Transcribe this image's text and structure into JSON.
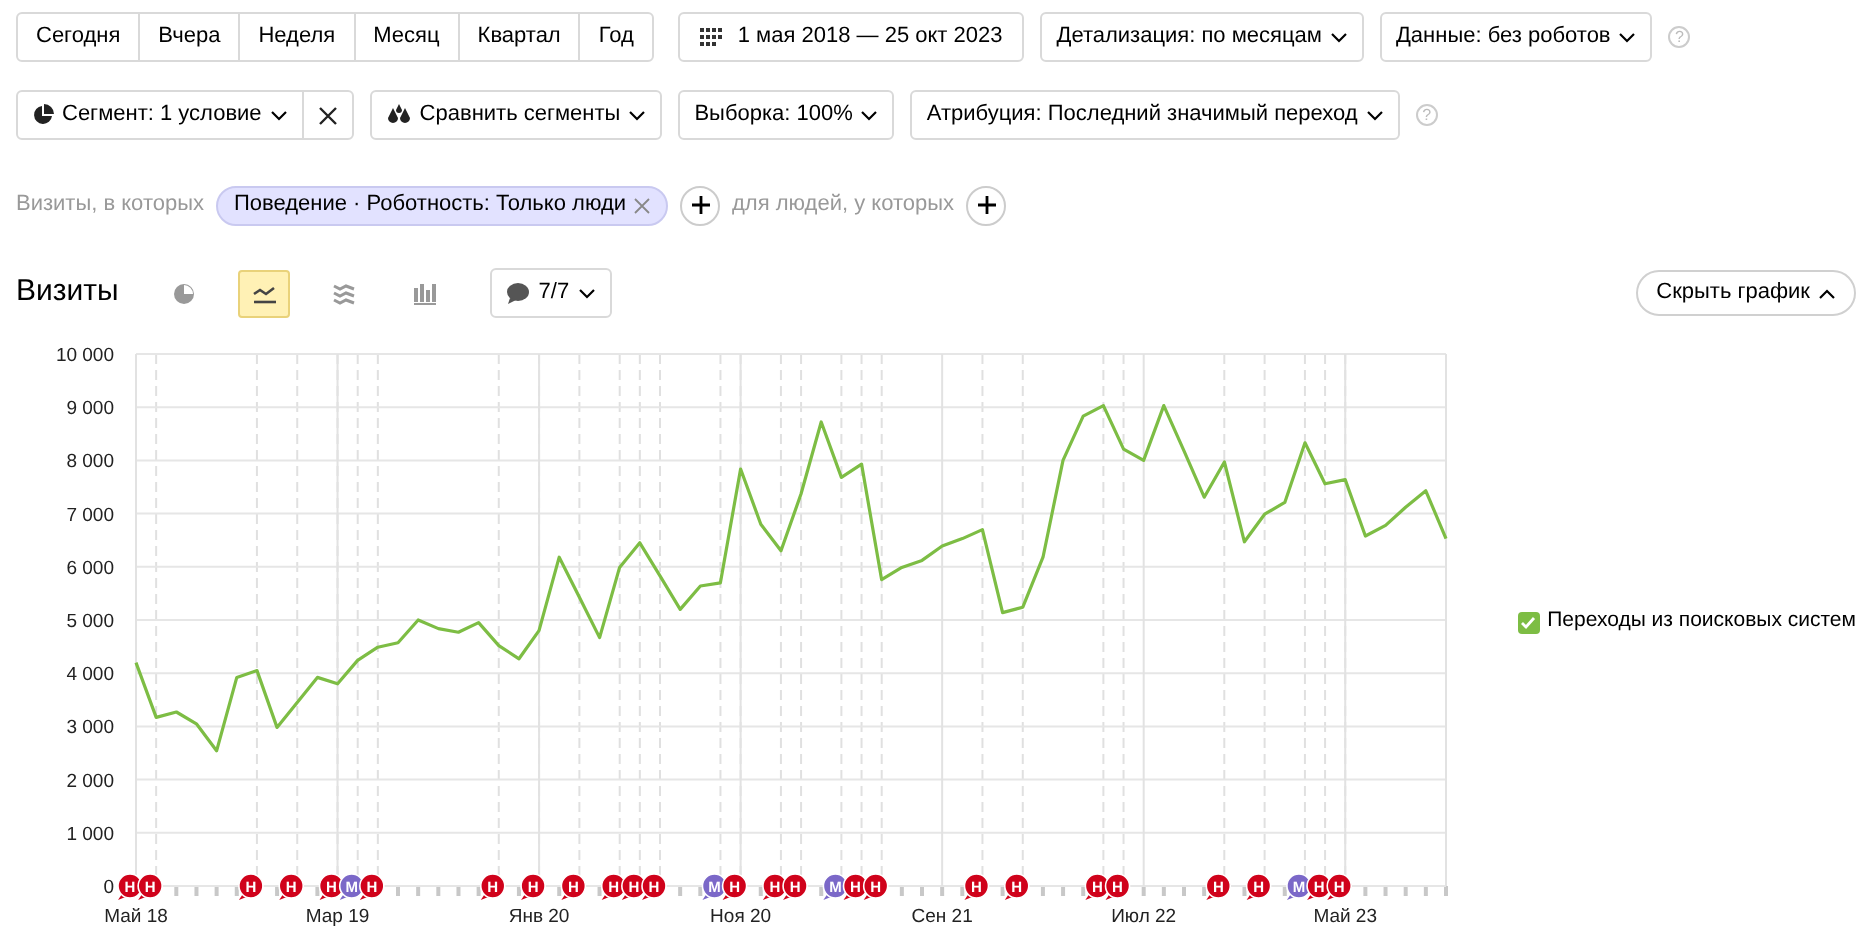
{
  "periods": [
    {
      "label": "Сегодня",
      "selected": false
    },
    {
      "label": "Вчера",
      "selected": false
    },
    {
      "label": "Неделя",
      "selected": false
    },
    {
      "label": "Месяц",
      "selected": false
    },
    {
      "label": "Квартал",
      "selected": false
    },
    {
      "label": "Год",
      "selected": false
    }
  ],
  "date_range": "1 мая 2018 — 25 окт 2023",
  "detail_dropdown": "Детализация: по месяцам",
  "data_dropdown": "Данные: без роботов",
  "help_1": "?",
  "segment_dropdown": "Сегмент: 1 условие",
  "compare_dropdown": "Сравнить сегменты",
  "sample_dropdown": "Выборка: 100%",
  "attribution_dropdown": "Атрибуция: Последний значимый переход",
  "help_2": "?",
  "filter": {
    "prefix": "Визиты, в которых",
    "condition": "Поведение · Роботность: Только люди",
    "people_label": "для людей, у которых"
  },
  "report_title": "Визиты",
  "chart_types": [
    {
      "kind": "pie",
      "selected": false
    },
    {
      "kind": "line",
      "selected": true
    },
    {
      "kind": "area",
      "selected": false
    },
    {
      "kind": "bar",
      "selected": false
    }
  ],
  "notes_button": "7/7",
  "hide_chart_button": "Скрыть график",
  "legend": [
    {
      "checked": true
    }
  ],
  "chart_data": {
    "type": "line",
    "categories": [
      "Май 18",
      null,
      null,
      null,
      null,
      null,
      null,
      null,
      null,
      null,
      "Мар 19",
      null,
      null,
      null,
      null,
      null,
      null,
      null,
      null,
      null,
      "Янв 20",
      null,
      null,
      null,
      null,
      null,
      null,
      null,
      null,
      null,
      "Ноя 20",
      null,
      null,
      null,
      null,
      null,
      null,
      null,
      null,
      null,
      "Сен 21",
      null,
      null,
      null,
      null,
      null,
      null,
      null,
      null,
      null,
      "Июл 22",
      null,
      null,
      null,
      null,
      null,
      null,
      null,
      null,
      null,
      "Май 23",
      null,
      null,
      null,
      null,
      null
    ],
    "series": [
      {
        "name": "Переходы из поисковых систем",
        "color": "#7dbd44",
        "values": [
          4200,
          3170,
          3270,
          3050,
          2540,
          3920,
          4050,
          2980,
          3450,
          3920,
          3800,
          4240,
          4490,
          4570,
          5000,
          4840,
          4770,
          4950,
          4520,
          4270,
          4800,
          6180,
          5430,
          4670,
          5990,
          6450,
          5830,
          5200,
          5640,
          5700,
          7840,
          6800,
          6300,
          7370,
          8720,
          7680,
          7930,
          5760,
          5990,
          6120,
          6390,
          6530,
          6700,
          5140,
          5240,
          6180,
          8000,
          8830,
          9030,
          8210,
          8000,
          9030,
          8180,
          7310,
          7970,
          6470,
          6990,
          7210,
          8330,
          7560,
          7640,
          6580,
          6780,
          7120,
          7430,
          6530
        ]
      }
    ],
    "ylim": [
      0,
      10000
    ],
    "yticks": [
      {
        "value": 0,
        "label": "0"
      },
      {
        "value": 1000,
        "label": "1 000"
      },
      {
        "value": 2000,
        "label": "2 000"
      },
      {
        "value": 3000,
        "label": "3 000"
      },
      {
        "value": 4000,
        "label": "4 000"
      },
      {
        "value": 5000,
        "label": "5 000"
      },
      {
        "value": 6000,
        "label": "6 000"
      },
      {
        "value": 7000,
        "label": "7 000"
      },
      {
        "value": 8000,
        "label": "8 000"
      },
      {
        "value": 9000,
        "label": "9 000"
      },
      {
        "value": 10000,
        "label": "10 000"
      }
    ],
    "grid": true
  },
  "event_markers": [
    {
      "event": true,
      "label": "Н",
      "color": "#d0021b"
    },
    {
      "event": true,
      "label": "Н",
      "color": "#d0021b"
    },
    {
      "event": false
    },
    {
      "event": false
    },
    {
      "event": false
    },
    {
      "event": false
    },
    {
      "event": true,
      "label": "Н",
      "color": "#d0021b"
    },
    {
      "event": false
    },
    {
      "event": true,
      "label": "Н",
      "color": "#d0021b"
    },
    {
      "event": false
    },
    {
      "event": true,
      "label": "Н",
      "color": "#d0021b"
    },
    {
      "event": true,
      "label": "М",
      "color": "#7b68c8"
    },
    {
      "event": true,
      "label": "Н",
      "color": "#d0021b"
    },
    {
      "event": false
    },
    {
      "event": false
    },
    {
      "event": false
    },
    {
      "event": false
    },
    {
      "event": false
    },
    {
      "event": true,
      "label": "Н",
      "color": "#d0021b"
    },
    {
      "event": false
    },
    {
      "event": true,
      "label": "Н",
      "color": "#d0021b"
    },
    {
      "event": false
    },
    {
      "event": true,
      "label": "Н",
      "color": "#d0021b"
    },
    {
      "event": false
    },
    {
      "event": true,
      "label": "Н",
      "color": "#d0021b"
    },
    {
      "event": true,
      "label": "Н",
      "color": "#d0021b"
    },
    {
      "event": true,
      "label": "Н",
      "color": "#d0021b"
    },
    {
      "event": false
    },
    {
      "event": false
    },
    {
      "event": true,
      "label": "М",
      "color": "#7b68c8"
    },
    {
      "event": true,
      "label": "Н",
      "color": "#d0021b"
    },
    {
      "event": false
    },
    {
      "event": true,
      "label": "Н",
      "color": "#d0021b"
    },
    {
      "event": true,
      "label": "Н",
      "color": "#d0021b"
    },
    {
      "event": false
    },
    {
      "event": true,
      "label": "М",
      "color": "#7b68c8"
    },
    {
      "event": true,
      "label": "Н",
      "color": "#d0021b"
    },
    {
      "event": true,
      "label": "Н",
      "color": "#d0021b"
    },
    {
      "event": false
    },
    {
      "event": false
    },
    {
      "event": false
    },
    {
      "event": false
    },
    {
      "event": true,
      "label": "Н",
      "color": "#d0021b"
    },
    {
      "event": false
    },
    {
      "event": true,
      "label": "Н",
      "color": "#d0021b"
    },
    {
      "event": false
    },
    {
      "event": false
    },
    {
      "event": false
    },
    {
      "event": true,
      "label": "Н",
      "color": "#d0021b"
    },
    {
      "event": true,
      "label": "Н",
      "color": "#d0021b"
    },
    {
      "event": false
    },
    {
      "event": false
    },
    {
      "event": false
    },
    {
      "event": false
    },
    {
      "event": true,
      "label": "Н",
      "color": "#d0021b"
    },
    {
      "event": false
    },
    {
      "event": true,
      "label": "Н",
      "color": "#d0021b"
    },
    {
      "event": false
    },
    {
      "event": true,
      "label": "М",
      "color": "#7b68c8"
    },
    {
      "event": true,
      "label": "Н",
      "color": "#d0021b"
    },
    {
      "event": true,
      "label": "Н",
      "color": "#d0021b"
    },
    {
      "event": false
    },
    {
      "event": false
    },
    {
      "event": false
    },
    {
      "event": false
    },
    {
      "event": false
    }
  ]
}
